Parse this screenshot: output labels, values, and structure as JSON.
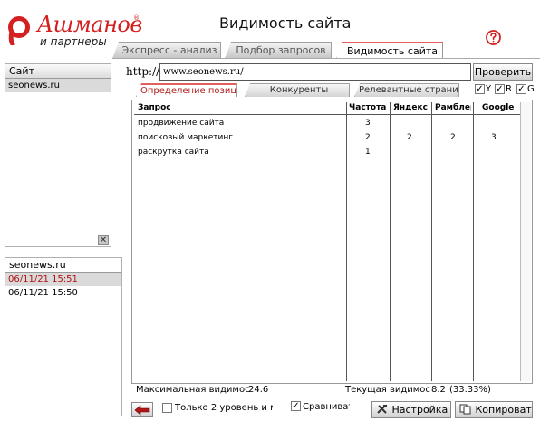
{
  "brand": {
    "name": "Ашманов",
    "registered": "®",
    "subtitle": "и партнеры",
    "accent_color": "#d42020"
  },
  "app": {
    "title": "Видимость сайта"
  },
  "main_tabs": [
    {
      "label": "Экспресс - анализ",
      "active": false
    },
    {
      "label": "Подбор запросов",
      "active": false
    },
    {
      "label": "Видимость сайта",
      "active": true
    }
  ],
  "sites_panel": {
    "header": "Сайт",
    "items": [
      "seonews.ru"
    ]
  },
  "history_panel": {
    "header": "seonews.ru",
    "items": [
      "06/11/21 15:51",
      "06/11/21 15:50"
    ]
  },
  "url_row": {
    "prefix": "http://",
    "value": "www.seonews.ru/",
    "check_button": "Проверить"
  },
  "sub_tabs": [
    {
      "label": "Определение позиций",
      "active": true
    },
    {
      "label": "Конкуренты",
      "active": false
    },
    {
      "label": "Релевантные страницы",
      "active": false
    }
  ],
  "engine_filters": [
    {
      "label": "Y",
      "checked": true
    },
    {
      "label": "R",
      "checked": true
    },
    {
      "label": "G",
      "checked": true
    }
  ],
  "table": {
    "columns": [
      "Запрос",
      "Частота",
      "Яндекс",
      "Рамблер",
      "Google"
    ],
    "rows": [
      {
        "query": "продвижение сайта",
        "freq": "3",
        "yandex": "",
        "rambler": "",
        "google": ""
      },
      {
        "query": "поисковый маркетинг",
        "freq": "2",
        "yandex": "2.",
        "rambler": "2",
        "google": "3."
      },
      {
        "query": "раскрутка сайта",
        "freq": "1",
        "yandex": "",
        "rambler": "",
        "google": ""
      }
    ]
  },
  "stats": {
    "max_label": "Максимальная видимость",
    "max_value": "24.6",
    "current_label": "Текущая видимость",
    "current_value": "8.2",
    "current_pct": "(33.33%)"
  },
  "bottom": {
    "level2_label": "Только 2 уровень и м",
    "level2_checked": false,
    "compare_label": "Сравнивать",
    "compare_checked": true,
    "settings_button": "Настройка",
    "copy_button": "Копировать"
  }
}
